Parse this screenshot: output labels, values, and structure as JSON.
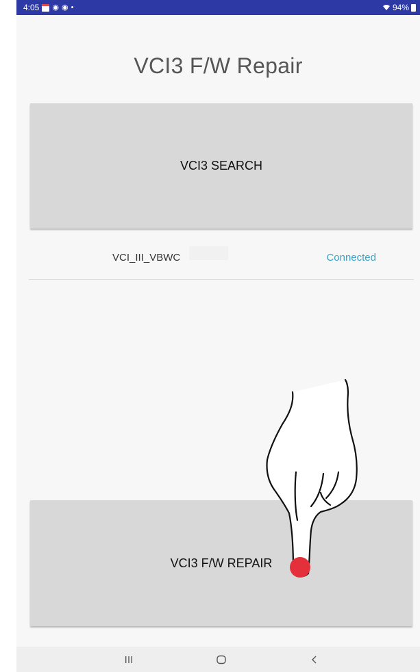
{
  "status_bar": {
    "time": "4:05",
    "battery": "94%"
  },
  "page": {
    "title": "VCI3 F/W Repair"
  },
  "buttons": {
    "search_label": "VCI3 SEARCH",
    "repair_label": "VCI3 F/W REPAIR"
  },
  "device": {
    "name": "VCI_III_VBWC",
    "status": "Connected"
  },
  "nav_bar": {
    "recent_icon": "recent-apps-icon",
    "home_icon": "home-icon",
    "back_icon": "back-icon"
  },
  "colors": {
    "status_bar_bg": "#2d3aa5",
    "button_bg": "#d8d8d8",
    "connected_text": "#3aa3c6",
    "tap_indicator": "#e3303a"
  }
}
